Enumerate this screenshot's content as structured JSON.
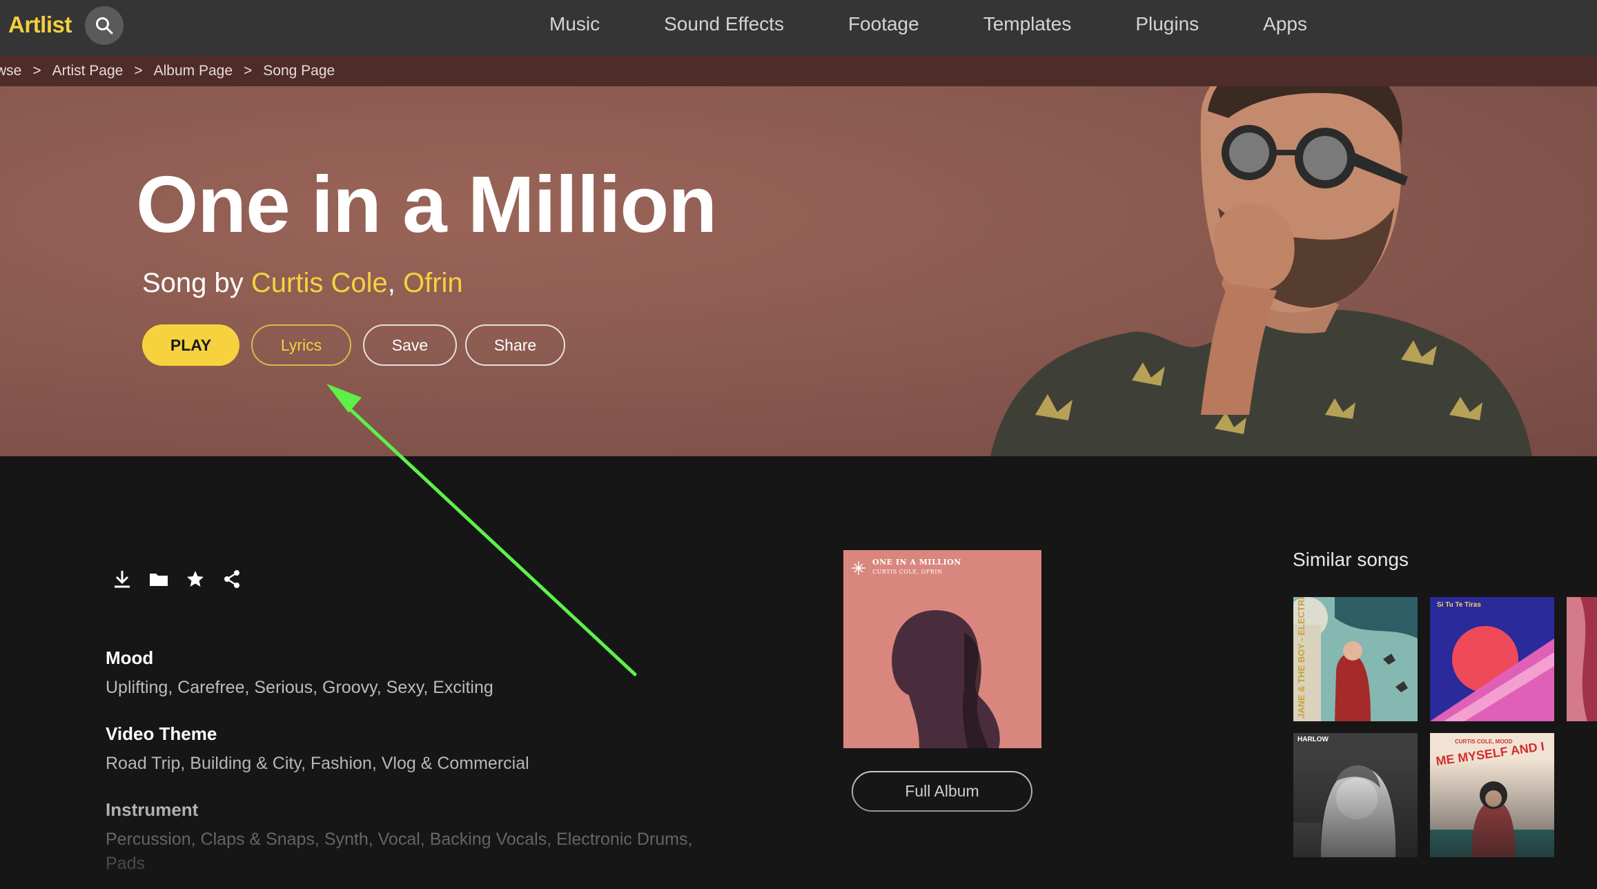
{
  "nav": {
    "logo": "Artlist",
    "search_icon": "search-icon",
    "items": [
      "Music",
      "Sound Effects",
      "Footage",
      "Templates",
      "Plugins",
      "Apps"
    ]
  },
  "breadcrumb": [
    "wse",
    "Artist Page",
    "Album Page",
    "Song Page"
  ],
  "hero": {
    "title": "One in a Million",
    "by_label": "Song by",
    "artists": [
      "Curtis Cole",
      "Ofrin"
    ],
    "artist_separator": ",",
    "buttons": {
      "play": "PLAY",
      "lyrics": "Lyrics",
      "save": "Save",
      "share": "Share"
    }
  },
  "actions": [
    "download-icon",
    "folder-icon",
    "star-icon",
    "share-icon"
  ],
  "details": {
    "mood_label": "Mood",
    "mood_value": "Uplifting, Carefree, Serious, Groovy, Sexy, Exciting",
    "theme_label": "Video Theme",
    "theme_value": "Road Trip, Building & City, Fashion, Vlog & Commercial",
    "instrument_label": "Instrument",
    "instrument_value_line1": "Percussion, Claps & Snaps, Synth, Vocal, Backing Vocals, Electronic Drums,",
    "instrument_value_line2": "Pads"
  },
  "album": {
    "cover_title": "ONE IN A MILLION",
    "cover_artists": "CURTIS COLE, OFRIN",
    "full_album_label": "Full Album"
  },
  "similar": {
    "title": "Similar songs",
    "thumb_texts": [
      "JANE & THE BOY - ELECTRIC",
      "Si Tu Te Tiras",
      "HARLOW",
      "CURTIS COLE, MOOD",
      "ME MYSELF AND I"
    ]
  },
  "colors": {
    "accent": "#f6d23e",
    "annotation_arrow": "#5ef04a"
  }
}
